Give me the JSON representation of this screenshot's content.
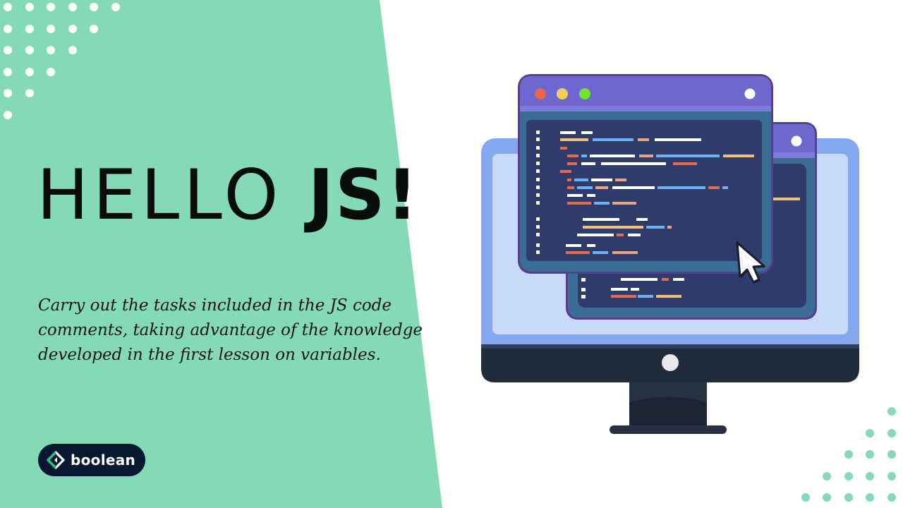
{
  "slide": {
    "title_regular": "HELLO",
    "title_bold": "JS!",
    "description": "Carry out the tasks included in the JS code comments, taking advantage of the knowledge developed in the first lesson on variables."
  },
  "brand": {
    "name": "boolean",
    "logo_icon": "boolean-diamond-icon"
  },
  "illustration": {
    "icon": "computer-monitor-with-code-windows-icon",
    "cursor_icon": "mouse-pointer-icon"
  },
  "colors": {
    "panel_green": "#84dab7",
    "title_text": "#060d0a",
    "logo_bg": "#071830",
    "window_header": "#6e67d0",
    "code_bg": "#2f3c6b",
    "monitor_frame": "#84a8f0"
  }
}
